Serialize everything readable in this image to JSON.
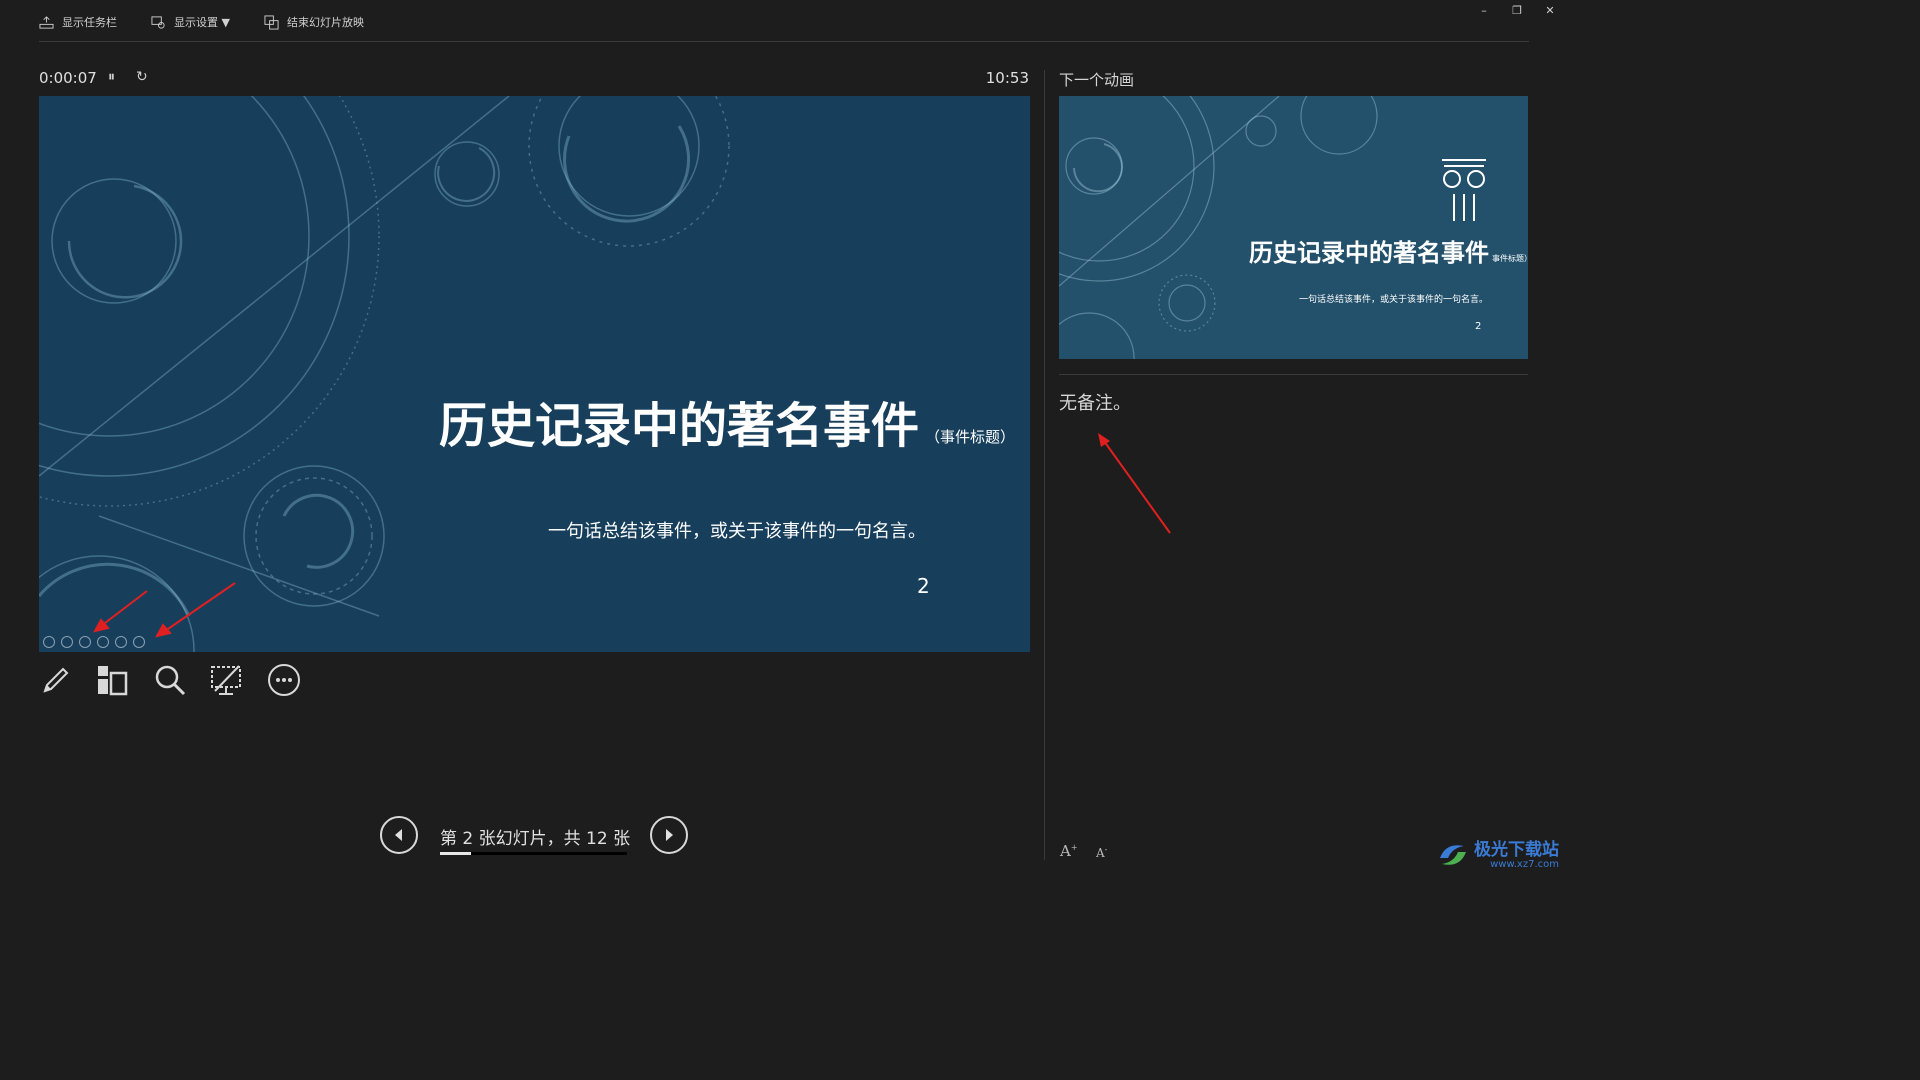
{
  "toolbar": {
    "show_taskbar": "显示任务栏",
    "display_settings": "显示设置 ▼",
    "end_slideshow": "结束幻灯片放映"
  },
  "window": {
    "minimize": "–",
    "restore": "❐",
    "close": "✕"
  },
  "timer": {
    "elapsed": "0:00:07",
    "pause_icon": "pause-icon",
    "reset_icon": "reset-icon"
  },
  "clock": "10:53",
  "slide": {
    "title": "历史记录中的著名事件",
    "title_sub": "（事件标题）",
    "quote": "一句话总结该事件，或关于该事件的一句名言。",
    "number": "2",
    "background_color": "#173f5c"
  },
  "tools": [
    "pen-icon",
    "slides-grid-icon",
    "zoom-icon",
    "screen-icon",
    "more-icon"
  ],
  "navigation": {
    "label": "第 2 张幻灯片，共 12 张",
    "current": 2,
    "total": 12,
    "progress_fraction": 0.167
  },
  "next_panel": {
    "label": "下一个动画",
    "preview": {
      "title": "历史记录中的著名事件",
      "title_sub": "事件标题）",
      "quote": "一句话总结该事件，或关于该事件的一句名言。",
      "number": "2"
    }
  },
  "notes": {
    "text": "无备注。"
  },
  "font_controls": {
    "increase": "A",
    "decrease": "A"
  },
  "watermark": {
    "text": "极光下载站",
    "url": "www.xz7.com"
  }
}
